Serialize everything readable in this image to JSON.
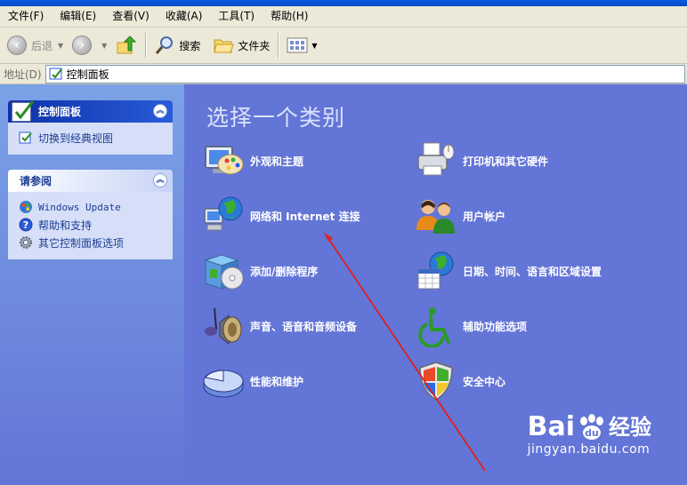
{
  "menu": [
    "文件(F)",
    "编辑(E)",
    "查看(V)",
    "收藏(A)",
    "工具(T)",
    "帮助(H)"
  ],
  "toolbar": {
    "back_label": "后退",
    "search_label": "搜索",
    "folders_label": "文件夹"
  },
  "address": {
    "label": "地址(D)",
    "value": "控制面板"
  },
  "sidebar": {
    "panel1": {
      "title": "控制面板",
      "items": [
        "切换到经典视图"
      ]
    },
    "panel2": {
      "title": "请参阅",
      "items": [
        "Windows Update",
        "帮助和支持",
        "其它控制面板选项"
      ]
    }
  },
  "main": {
    "heading": "选择一个类别",
    "categories": [
      "外观和主题",
      "打印机和其它硬件",
      "网络和 Internet 连接",
      "用户帐户",
      "添加/删除程序",
      "日期、时间、语言和区域设置",
      "声音、语音和音频设备",
      "辅助功能选项",
      "性能和维护",
      "安全中心"
    ]
  },
  "watermark": {
    "brand": "Bai",
    "brand2": "经验",
    "url": "jingyan.baidu.com"
  },
  "colors": {
    "main_bg": "#6375d6",
    "sidebar_top": "#7ba2e7",
    "annotation_arrow": "#e0201c"
  }
}
